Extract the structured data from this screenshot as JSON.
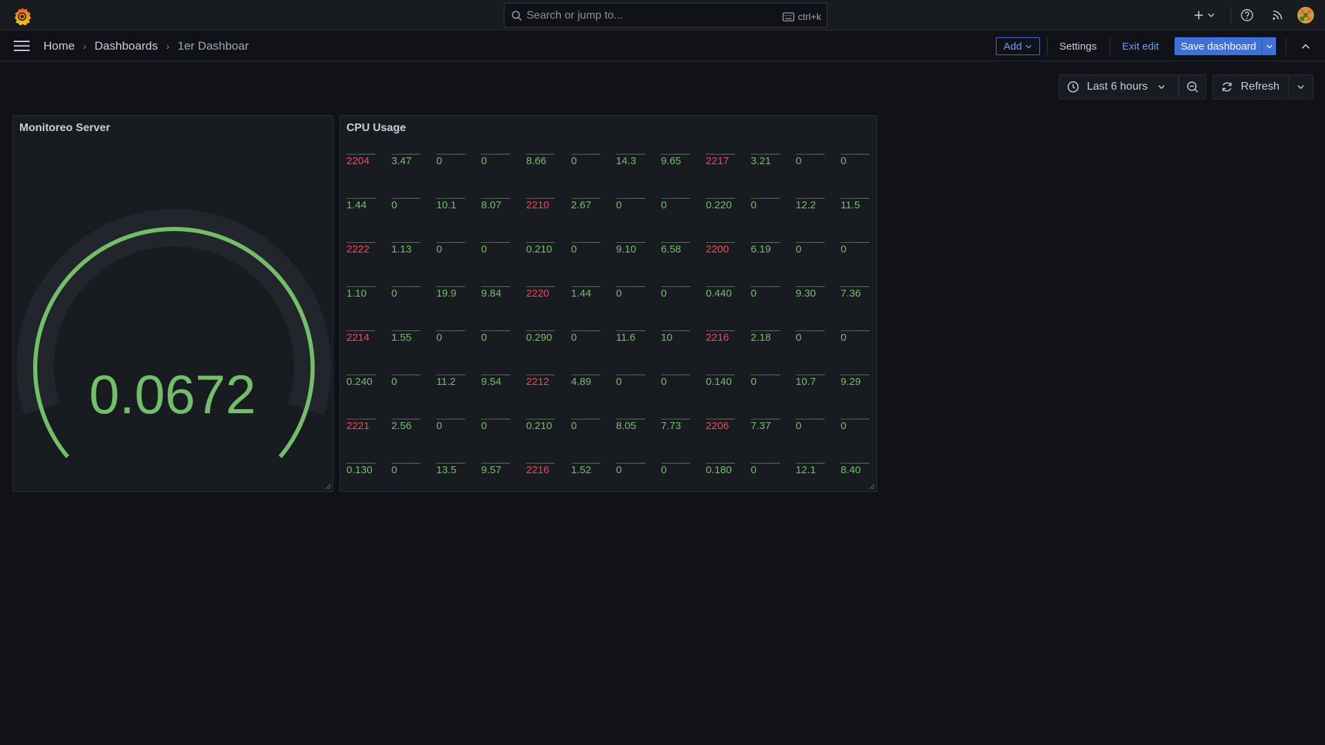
{
  "colors": {
    "green": "#73bf69",
    "red": "#f2495c",
    "accent": "#3d71d9"
  },
  "topbar": {
    "search_placeholder": "Search or jump to...",
    "shortcut": "ctrl+k"
  },
  "navbar": {
    "breadcrumbs": [
      "Home",
      "Dashboards",
      "1er Dashboar"
    ],
    "add_label": "Add",
    "settings_label": "Settings",
    "exit_edit_label": "Exit edit",
    "save_label": "Save dashboard"
  },
  "time": {
    "range_label": "Last 6 hours",
    "refresh_label": "Refresh"
  },
  "panels": {
    "gauge": {
      "title": "Monitoreo Server",
      "value": "0.0672",
      "fill_fraction": 1.0
    },
    "cpu": {
      "title": "CPU Usage",
      "rows": [
        [
          {
            "v": "2204",
            "s": "red"
          },
          {
            "v": "3.47",
            "s": "green"
          },
          {
            "v": "0",
            "s": "green"
          },
          {
            "v": "0",
            "s": "green"
          },
          {
            "v": "8.66",
            "s": "green"
          },
          {
            "v": "0",
            "s": "green"
          },
          {
            "v": "14.3",
            "s": "green"
          },
          {
            "v": "9.65",
            "s": "green"
          },
          {
            "v": "2217",
            "s": "red"
          },
          {
            "v": "3.21",
            "s": "green"
          },
          {
            "v": "0",
            "s": "green"
          },
          {
            "v": "0",
            "s": "green"
          }
        ],
        [
          {
            "v": "1.44",
            "s": "green"
          },
          {
            "v": "0",
            "s": "green"
          },
          {
            "v": "10.1",
            "s": "green"
          },
          {
            "v": "8.07",
            "s": "green"
          },
          {
            "v": "2210",
            "s": "red"
          },
          {
            "v": "2.67",
            "s": "green"
          },
          {
            "v": "0",
            "s": "green"
          },
          {
            "v": "0",
            "s": "green"
          },
          {
            "v": "0.220",
            "s": "green"
          },
          {
            "v": "0",
            "s": "green"
          },
          {
            "v": "12.2",
            "s": "green"
          },
          {
            "v": "11.5",
            "s": "green"
          }
        ],
        [
          {
            "v": "2222",
            "s": "red"
          },
          {
            "v": "1.13",
            "s": "green"
          },
          {
            "v": "0",
            "s": "green"
          },
          {
            "v": "0",
            "s": "green"
          },
          {
            "v": "0.210",
            "s": "green"
          },
          {
            "v": "0",
            "s": "green"
          },
          {
            "v": "9.10",
            "s": "green"
          },
          {
            "v": "6.58",
            "s": "green"
          },
          {
            "v": "2200",
            "s": "red"
          },
          {
            "v": "6.19",
            "s": "green"
          },
          {
            "v": "0",
            "s": "green"
          },
          {
            "v": "0",
            "s": "green"
          }
        ],
        [
          {
            "v": "1.10",
            "s": "green"
          },
          {
            "v": "0",
            "s": "green"
          },
          {
            "v": "19.9",
            "s": "green"
          },
          {
            "v": "9.84",
            "s": "green"
          },
          {
            "v": "2220",
            "s": "red"
          },
          {
            "v": "1.44",
            "s": "green"
          },
          {
            "v": "0",
            "s": "green"
          },
          {
            "v": "0",
            "s": "green"
          },
          {
            "v": "0.440",
            "s": "green"
          },
          {
            "v": "0",
            "s": "green"
          },
          {
            "v": "9.30",
            "s": "green"
          },
          {
            "v": "7.36",
            "s": "green"
          }
        ],
        [
          {
            "v": "2214",
            "s": "red"
          },
          {
            "v": "1.55",
            "s": "green"
          },
          {
            "v": "0",
            "s": "green"
          },
          {
            "v": "0",
            "s": "green"
          },
          {
            "v": "0.290",
            "s": "green"
          },
          {
            "v": "0",
            "s": "green"
          },
          {
            "v": "11.6",
            "s": "green"
          },
          {
            "v": "10",
            "s": "green"
          },
          {
            "v": "2216",
            "s": "red"
          },
          {
            "v": "2.18",
            "s": "green"
          },
          {
            "v": "0",
            "s": "green"
          },
          {
            "v": "0",
            "s": "green"
          }
        ],
        [
          {
            "v": "0.240",
            "s": "green"
          },
          {
            "v": "0",
            "s": "green"
          },
          {
            "v": "11.2",
            "s": "green"
          },
          {
            "v": "9.54",
            "s": "green"
          },
          {
            "v": "2212",
            "s": "red"
          },
          {
            "v": "4.89",
            "s": "green"
          },
          {
            "v": "0",
            "s": "green"
          },
          {
            "v": "0",
            "s": "green"
          },
          {
            "v": "0.140",
            "s": "green"
          },
          {
            "v": "0",
            "s": "green"
          },
          {
            "v": "10.7",
            "s": "green"
          },
          {
            "v": "9.29",
            "s": "green"
          }
        ],
        [
          {
            "v": "2221",
            "s": "red"
          },
          {
            "v": "2.56",
            "s": "green"
          },
          {
            "v": "0",
            "s": "green"
          },
          {
            "v": "0",
            "s": "green"
          },
          {
            "v": "0.210",
            "s": "green"
          },
          {
            "v": "0",
            "s": "green"
          },
          {
            "v": "8.05",
            "s": "green"
          },
          {
            "v": "7.73",
            "s": "green"
          },
          {
            "v": "2206",
            "s": "red"
          },
          {
            "v": "7.37",
            "s": "green"
          },
          {
            "v": "0",
            "s": "green"
          },
          {
            "v": "0",
            "s": "green"
          }
        ],
        [
          {
            "v": "0.130",
            "s": "green"
          },
          {
            "v": "0",
            "s": "green"
          },
          {
            "v": "13.5",
            "s": "green"
          },
          {
            "v": "9.57",
            "s": "green"
          },
          {
            "v": "2216",
            "s": "red"
          },
          {
            "v": "1.52",
            "s": "green"
          },
          {
            "v": "0",
            "s": "green"
          },
          {
            "v": "0",
            "s": "green"
          },
          {
            "v": "0.180",
            "s": "green"
          },
          {
            "v": "0",
            "s": "green"
          },
          {
            "v": "12.1",
            "s": "green"
          },
          {
            "v": "8.40",
            "s": "green"
          }
        ]
      ]
    }
  },
  "icons": {
    "logo": "grafana-logo-icon",
    "search": "search-icon",
    "keyboard": "keyboard-icon",
    "plus": "plus-icon",
    "help": "help-icon",
    "news": "rss-icon",
    "menu": "hamburger-menu-icon",
    "clock": "clock-icon",
    "zoom_out": "zoom-out-icon",
    "refresh": "refresh-icon"
  }
}
